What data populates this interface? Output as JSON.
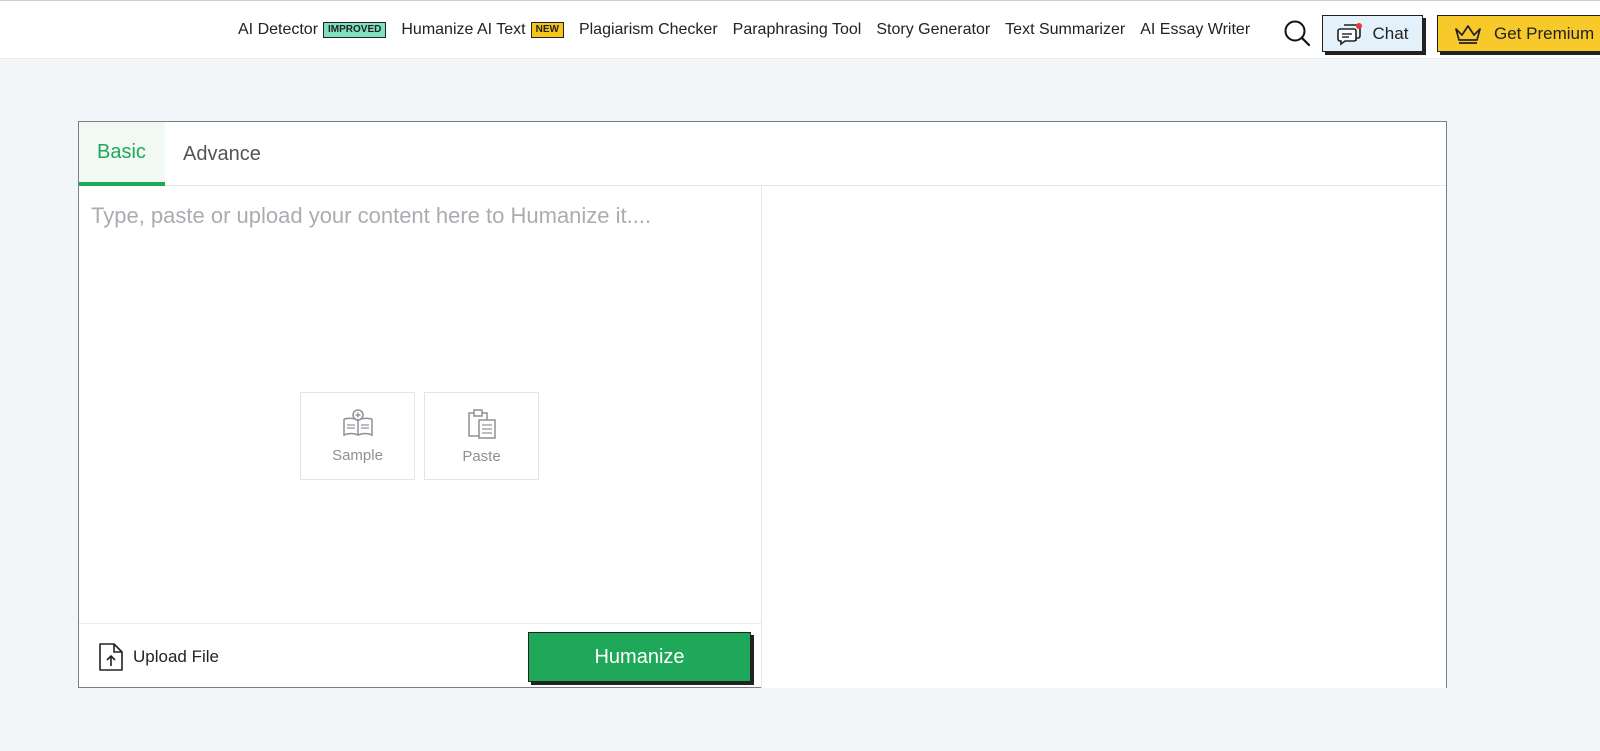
{
  "nav": {
    "items": [
      {
        "label": "AI Detector",
        "badge": "IMPROVED"
      },
      {
        "label": "Humanize AI Text",
        "badge": "NEW"
      },
      {
        "label": "Plagiarism Checker"
      },
      {
        "label": "Paraphrasing Tool"
      },
      {
        "label": "Story Generator"
      },
      {
        "label": "Text Summarizer"
      },
      {
        "label": "AI Essay Writer"
      }
    ],
    "chat_label": "Chat",
    "premium_label": "Get Premium"
  },
  "tabs": [
    {
      "label": "Basic",
      "active": true
    },
    {
      "label": "Advance",
      "active": false
    }
  ],
  "editor": {
    "placeholder": "Type, paste or upload your content here to Humanize it....",
    "sample_label": "Sample",
    "paste_label": "Paste",
    "upload_label": "Upload File",
    "humanize_label": "Humanize"
  },
  "colors": {
    "accent_green": "#1fa85a",
    "premium_yellow": "#f8c92a",
    "chat_blue": "#e4f1fb",
    "badge_improved": "#7fe0c0",
    "badge_new": "#f5c518"
  }
}
